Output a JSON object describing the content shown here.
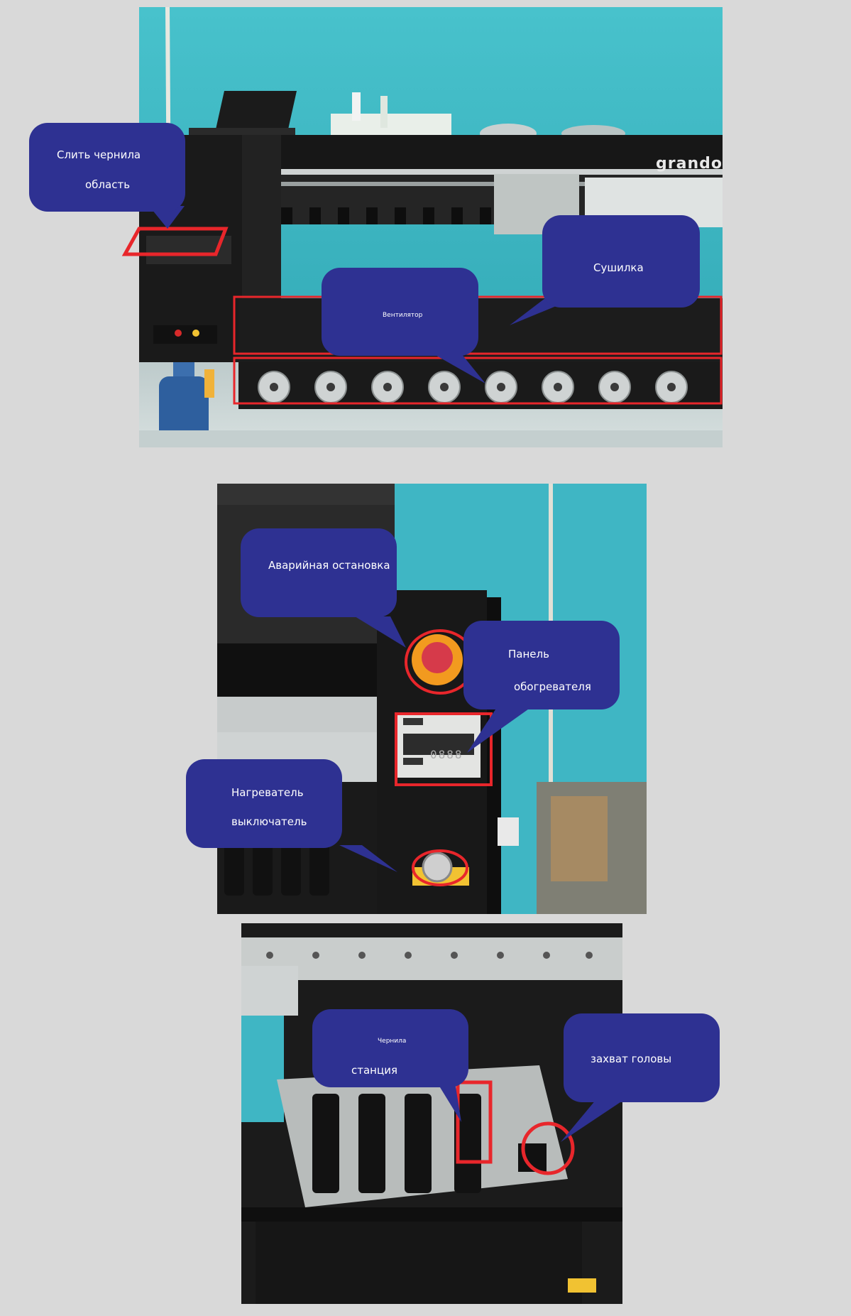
{
  "page": {
    "background": "#d9d9d9"
  },
  "colors": {
    "callout_fill": "#2e3192",
    "highlight_red": "#e8262b",
    "wall": "#3fb6c4"
  },
  "photos": {
    "printer_overview": {
      "brand_text": "grando",
      "callouts": {
        "drain_ink_line1": "Слить чернила",
        "drain_ink_line2": "область",
        "dryer": "Сушилка",
        "fan": "Вентилятор"
      }
    },
    "control_panel": {
      "display_readout": "0888",
      "callouts": {
        "emergency_stop": "Аварийная остановка",
        "heater_panel_line1": "Панель",
        "heater_panel_line2": "обогревателя",
        "heater_switch_line1": "Нагреватель",
        "heater_switch_line2": "выключатель"
      }
    },
    "ink_station": {
      "callouts": {
        "ink_station_line1": "Чернила",
        "ink_station_line2": "станция",
        "head_capture": "захват головы"
      }
    }
  }
}
